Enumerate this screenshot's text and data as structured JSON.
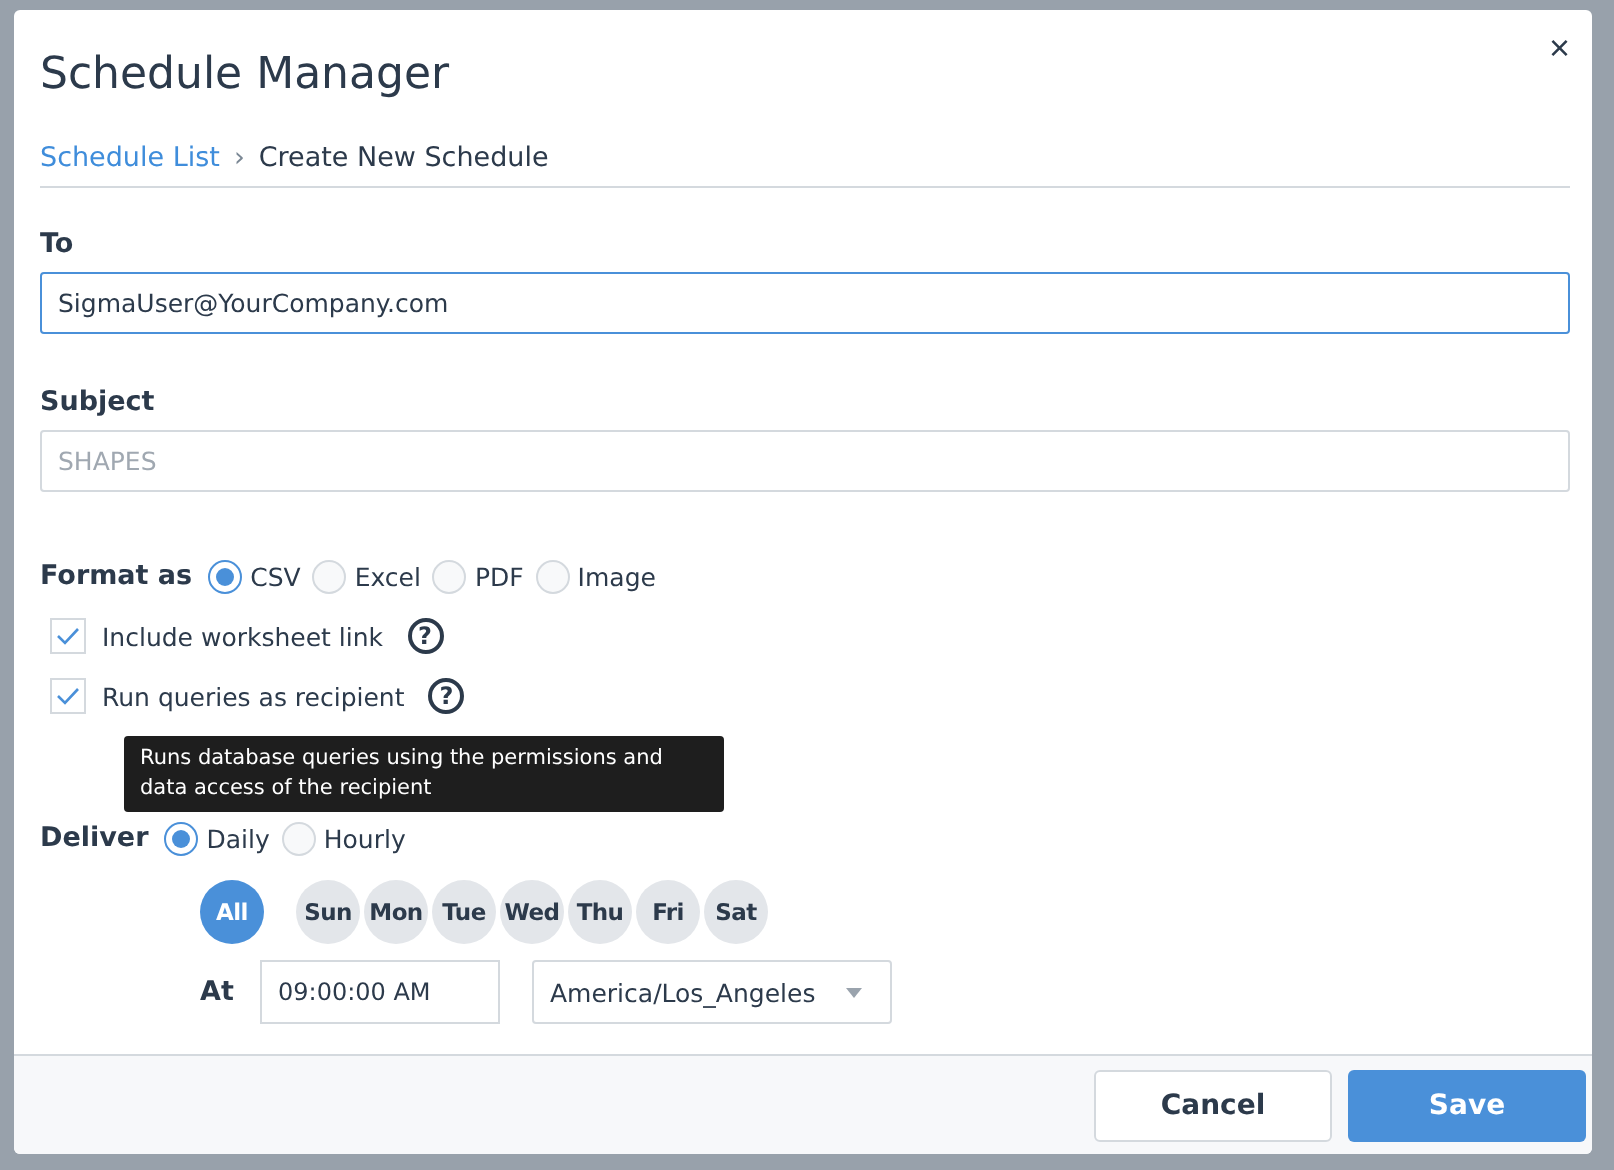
{
  "dialog": {
    "title": "Schedule Manager",
    "close": "×"
  },
  "breadcrumb": {
    "link": "Schedule List",
    "separator": "›",
    "current": "Create New Schedule"
  },
  "to": {
    "label": "To",
    "value": "SigmaUser@YourCompany.com"
  },
  "subject": {
    "label": "Subject",
    "placeholder": "SHAPES"
  },
  "format": {
    "label": "Format as",
    "options": [
      {
        "label": "CSV",
        "selected": true
      },
      {
        "label": "Excel",
        "selected": false
      },
      {
        "label": "PDF",
        "selected": false
      },
      {
        "label": "Image",
        "selected": false
      }
    ]
  },
  "options": [
    {
      "label": "Include worksheet link",
      "checked": true,
      "help": "?"
    },
    {
      "label": "Run queries as recipient",
      "checked": true,
      "help": "?"
    }
  ],
  "tooltip": "Runs database queries using the permissions and data access of the recipient",
  "deliver": {
    "label": "Deliver",
    "options": [
      {
        "label": "Daily",
        "selected": true
      },
      {
        "label": "Hourly",
        "selected": false
      }
    ],
    "days": [
      {
        "label": "All",
        "selected": true
      },
      {
        "label": "Sun",
        "selected": false
      },
      {
        "label": "Mon",
        "selected": false
      },
      {
        "label": "Tue",
        "selected": false
      },
      {
        "label": "Wed",
        "selected": false
      },
      {
        "label": "Thu",
        "selected": false
      },
      {
        "label": "Fri",
        "selected": false
      },
      {
        "label": "Sat",
        "selected": false
      }
    ],
    "at_label": "At",
    "time": "09:00:00 AM",
    "timezone": "America/Los_Angeles"
  },
  "buttons": {
    "cancel": "Cancel",
    "save": "Save"
  }
}
